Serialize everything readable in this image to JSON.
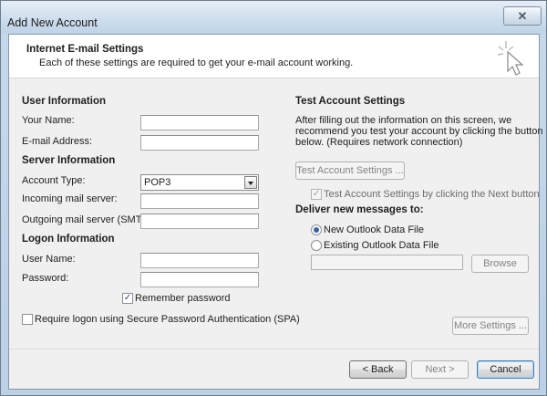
{
  "window": {
    "title": "Add New Account",
    "close_label": "✕"
  },
  "header": {
    "title": "Internet E-mail Settings",
    "subtitle": "Each of these settings are required to get your e-mail account working."
  },
  "user_info": {
    "heading": "User Information",
    "name_label": "Your Name:",
    "name_value": "",
    "email_label": "E-mail Address:",
    "email_value": ""
  },
  "server_info": {
    "heading": "Server Information",
    "account_type_label": "Account Type:",
    "account_type_value": "POP3",
    "incoming_label": "Incoming mail server:",
    "incoming_value": "",
    "outgoing_label": "Outgoing mail server (SMTP):",
    "outgoing_value": ""
  },
  "logon_info": {
    "heading": "Logon Information",
    "username_label": "User Name:",
    "username_value": "",
    "password_label": "Password:",
    "password_value": "",
    "remember_label": "Remember password",
    "remember_checked": true,
    "spa_label": "Require logon using Secure Password Authentication (SPA)",
    "spa_checked": false
  },
  "test_settings": {
    "heading": "Test Account Settings",
    "description_line1": "After filling out the information on this screen, we",
    "description_line2": "recommend you test your account by clicking the button",
    "description_line3": "below. (Requires network connection)",
    "test_button_label": "Test Account Settings ...",
    "auto_test_label": "Test Account Settings by clicking the Next button",
    "auto_test_checked": true
  },
  "delivery": {
    "heading": "Deliver new messages to:",
    "new_file_label": "New Outlook Data File",
    "existing_file_label": "Existing Outlook Data File",
    "selected": "new",
    "browse_label": "Browse"
  },
  "buttons": {
    "more_settings": "More Settings ...",
    "back": "< Back",
    "next": "Next >",
    "cancel": "Cancel"
  },
  "icons": {
    "close": "close-icon",
    "wizard": "sparkle-cursor-icon",
    "dropdown": "chevron-down-icon",
    "check": "checkmark-icon"
  }
}
